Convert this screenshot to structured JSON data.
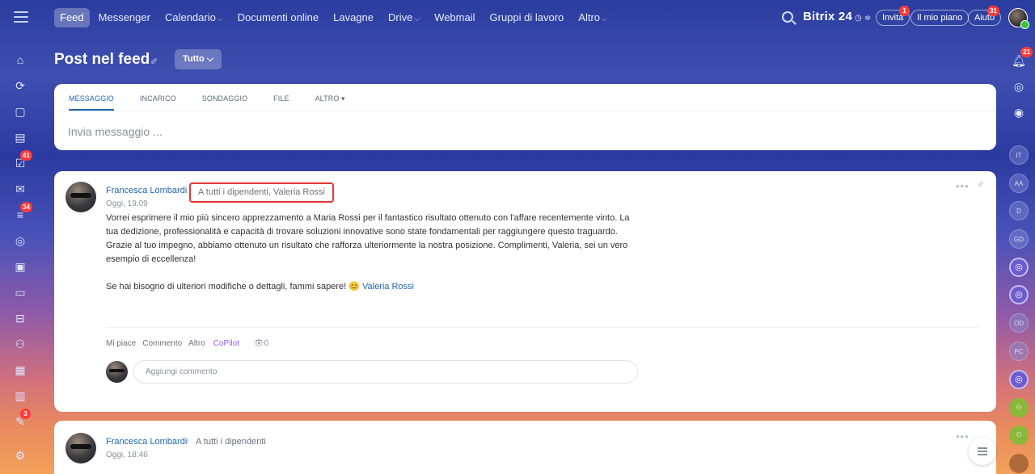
{
  "topbar": {
    "menu_icon": "hamburger-icon",
    "nav": [
      {
        "label": "Feed",
        "active": true,
        "dropdown": false
      },
      {
        "label": "Messenger",
        "active": false,
        "dropdown": false
      },
      {
        "label": "Calendario",
        "active": false,
        "dropdown": true
      },
      {
        "label": "Documenti online",
        "active": false,
        "dropdown": false
      },
      {
        "label": "Lavagne",
        "active": false,
        "dropdown": false
      },
      {
        "label": "Drive",
        "active": false,
        "dropdown": true
      },
      {
        "label": "Webmail",
        "active": false,
        "dropdown": false
      },
      {
        "label": "Gruppi di lavoro",
        "active": false,
        "dropdown": false
      },
      {
        "label": "Altro",
        "active": false,
        "dropdown": true
      }
    ],
    "brand": "Bitrix 24",
    "invite": "Invita",
    "invite_badge": "1",
    "plan": "Il mio piano",
    "help": "Aiuto",
    "help_badge": "31"
  },
  "sidebar": {
    "badges": {
      "tasks": "41",
      "feed": "34",
      "other": "3"
    }
  },
  "page": {
    "title": "Post nel feed",
    "filter": "Tutto"
  },
  "composer": {
    "tabs": [
      "Messaggio",
      "Incarico",
      "Sondaggio",
      "File",
      "Altro"
    ],
    "placeholder": "Invia messaggio ..."
  },
  "post1": {
    "author": "Francesca Lombardi",
    "recipients": "A tutti i dipendenti, Valeria Rossi",
    "time": "Oggi, 19:09",
    "paragraph1": "Vorrei esprimere il mio più sincero apprezzamento a Maria Rossi per il fantastico risultato ottenuto con l'affare recentemente vinto. La tua dedizione, professionalità e capacità di trovare soluzioni innovative sono state fondamentali per raggiungere questo traguardo. Grazie al tuo impegno, abbiamo ottenuto un risultato che rafforza ulteriormente la nostra posizione. Complimenti, Valeria, sei un vero esempio di eccellenza!",
    "paragraph2": "Se hai bisogno di ulteriori modifiche o dettagli, fammi sapere! 😊",
    "mention": "Valeria Rossi",
    "actions": {
      "like": "Mi piace",
      "comment": "Commento",
      "more": "Altro",
      "copilot": "CoPilot",
      "views": "👁0"
    },
    "comment_placeholder": "Aggiungi commento"
  },
  "post2": {
    "author": "Francesca Lombardi",
    "recipients": "A tutti i dipendenti",
    "time": "Oggi, 18:46"
  },
  "right": {
    "notif_badge": "21",
    "avatars": [
      "IT",
      "AA",
      "D",
      "GD",
      "OD",
      "PC"
    ]
  },
  "colors": {
    "link": "#2067b0",
    "highlight": "#e03a3a",
    "copilot": "#8b5cf6",
    "badge": "#ff3b3b"
  }
}
